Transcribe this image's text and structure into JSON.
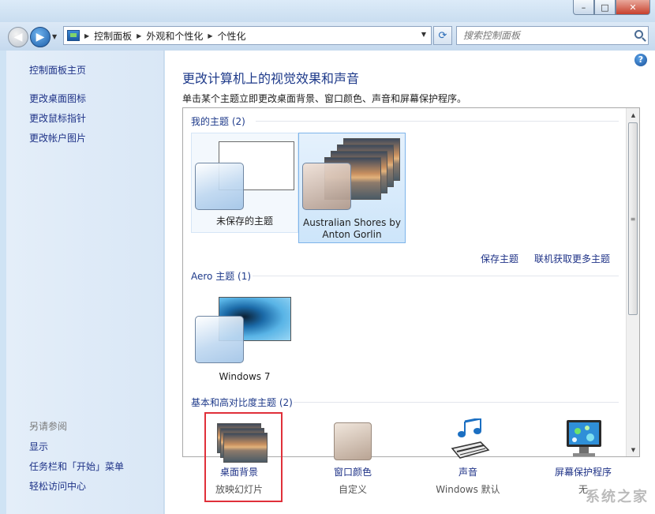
{
  "window": {
    "minimize": "–",
    "maximize": "□",
    "close": "✕"
  },
  "addressbar": {
    "crumbs": [
      "控制面板",
      "外观和个性化",
      "个性化"
    ]
  },
  "search": {
    "placeholder": "搜索控制面板"
  },
  "sidebar": {
    "top_links": [
      "控制面板主页",
      "更改桌面图标",
      "更改鼠标指针",
      "更改帐户图片"
    ],
    "see_also_title": "另请参阅",
    "see_also_links": [
      "显示",
      "任务栏和「开始」菜单",
      "轻松访问中心"
    ]
  },
  "main": {
    "title": "更改计算机上的视觉效果和声音",
    "description": "单击某个主题立即更改桌面背景、窗口颜色、声音和屏幕保护程序。",
    "my_themes": {
      "header": "我的主题 (2)",
      "themes": [
        {
          "name": "未保存的主题"
        },
        {
          "name": "Australian Shores by Anton Gorlin",
          "line1": "Australian Shores by",
          "line2": "Anton Gorlin"
        }
      ],
      "save_link": "保存主题",
      "online_link": "联机获取更多主题"
    },
    "aero_themes": {
      "header": "Aero 主题 (1)",
      "themes": [
        {
          "name": "Windows 7"
        }
      ]
    },
    "basic_header": "基本和高对比度主题 (2)"
  },
  "bottom": {
    "desktop_bg": {
      "label": "桌面背景",
      "value": "放映幻灯片"
    },
    "window_color": {
      "label": "窗口颜色",
      "value": "自定义"
    },
    "sounds": {
      "label": "声音",
      "value": "Windows 默认"
    },
    "screensaver": {
      "label": "屏幕保护程序",
      "value": "无"
    }
  },
  "icons": {
    "back": "back-arrow-icon",
    "forward": "forward-arrow-icon",
    "refresh": "refresh-icon",
    "search": "search-icon",
    "help": "help-icon"
  },
  "watermark": "系统之家",
  "colors": {
    "highlight": "#e0303a",
    "link": "#1e3287",
    "heading": "#1e3a8a"
  }
}
